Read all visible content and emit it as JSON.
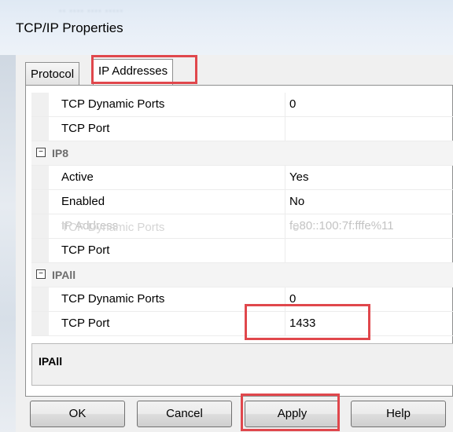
{
  "dialog": {
    "title": "TCP/IP Properties",
    "background_blur_text": "·· ···· ···· ·····"
  },
  "tabs": [
    {
      "label": "Protocol",
      "active": false
    },
    {
      "label": "IP Addresses",
      "active": true
    }
  ],
  "grid_rows": [
    {
      "type": "property",
      "name": "TCP Dynamic Ports",
      "value": "0"
    },
    {
      "type": "property",
      "name": "TCP Port",
      "value": ""
    },
    {
      "type": "category",
      "name": "IP8",
      "toggle": "⊟"
    },
    {
      "type": "property",
      "name": "Active",
      "value": "Yes"
    },
    {
      "type": "property",
      "name": "Enabled",
      "value": "No"
    },
    {
      "type": "dim",
      "name": "IP Address",
      "value": "fe80::100:7f:fffe%11"
    },
    {
      "type": "property",
      "name": "TCP Port",
      "value": ""
    },
    {
      "type": "category",
      "name": "IPAll",
      "toggle": "⊟"
    },
    {
      "type": "property",
      "name": "TCP Dynamic Ports",
      "value": "0"
    },
    {
      "type": "property",
      "name": "TCP Port",
      "value": "1433"
    }
  ],
  "ghost_row": {
    "name": "TCP Dynamic Ports",
    "value": "0"
  },
  "description": {
    "title": "IPAll"
  },
  "buttons": {
    "ok": "OK",
    "cancel": "Cancel",
    "apply": "Apply",
    "help": "Help"
  },
  "colors": {
    "highlight": "#e0474c",
    "category_text": "#6d6d6d"
  }
}
